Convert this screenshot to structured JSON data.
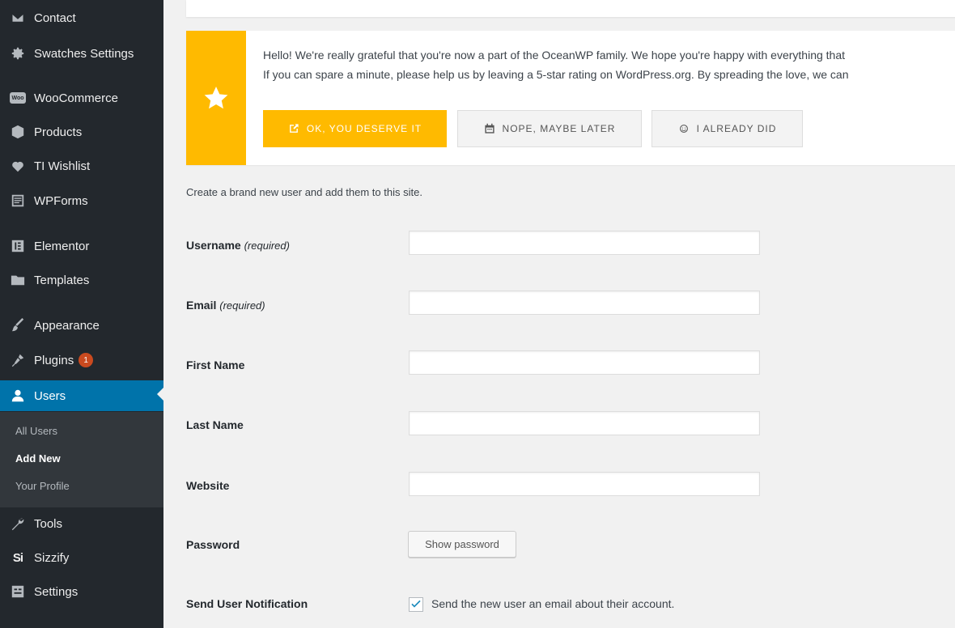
{
  "sidebar": {
    "items": [
      {
        "label": "Contact",
        "icon": "envelope-icon"
      },
      {
        "label": "Swatches Settings",
        "icon": "gear-icon"
      },
      {
        "label": "WooCommerce",
        "icon": "woocommerce-icon"
      },
      {
        "label": "Products",
        "icon": "cube-icon"
      },
      {
        "label": "TI Wishlist",
        "icon": "heart-icon"
      },
      {
        "label": "WPForms",
        "icon": "form-icon"
      },
      {
        "label": "Elementor",
        "icon": "elementor-icon"
      },
      {
        "label": "Templates",
        "icon": "folder-icon"
      },
      {
        "label": "Appearance",
        "icon": "paintbrush-icon"
      },
      {
        "label": "Plugins",
        "icon": "plug-icon",
        "badge": "1"
      },
      {
        "label": "Users",
        "icon": "user-icon",
        "active": true
      },
      {
        "label": "Tools",
        "icon": "wrench-icon"
      },
      {
        "label": "Sizzify",
        "icon": "sizzify-icon"
      },
      {
        "label": "Settings",
        "icon": "settings-icon"
      }
    ],
    "woo_icon_text": "Woo",
    "sizzify_icon_text": "Si",
    "submenu": [
      {
        "label": "All Users"
      },
      {
        "label": "Add New",
        "current": true
      },
      {
        "label": "Your Profile"
      }
    ]
  },
  "notice": {
    "line1": "Hello! We're really grateful that you're now a part of the OceanWP family. We hope you're happy with everything that",
    "line2": "If you can spare a minute, please help us by leaving a 5-star rating on WordPress.org. By spreading the love, we can",
    "buttons": {
      "ok": "OK, YOU DESERVE IT",
      "later": "NOPE, MAYBE LATER",
      "did": "I ALREADY DID"
    }
  },
  "form": {
    "description": "Create a brand new user and add them to this site.",
    "required_note": "(required)",
    "fields": {
      "username": {
        "label": "Username",
        "value": ""
      },
      "email": {
        "label": "Email",
        "value": ""
      },
      "first_name": {
        "label": "First Name",
        "value": ""
      },
      "last_name": {
        "label": "Last Name",
        "value": ""
      },
      "website": {
        "label": "Website",
        "value": ""
      }
    },
    "password_label": "Password",
    "show_password": "Show password",
    "notification_label": "Send User Notification",
    "notification_text": "Send the new user an email about their account.",
    "notification_checked": true
  },
  "colors": {
    "sidebar_bg": "#23282d",
    "active_bg": "#0073aa",
    "accent": "#ffba00",
    "badge": "#ca4a1f"
  }
}
